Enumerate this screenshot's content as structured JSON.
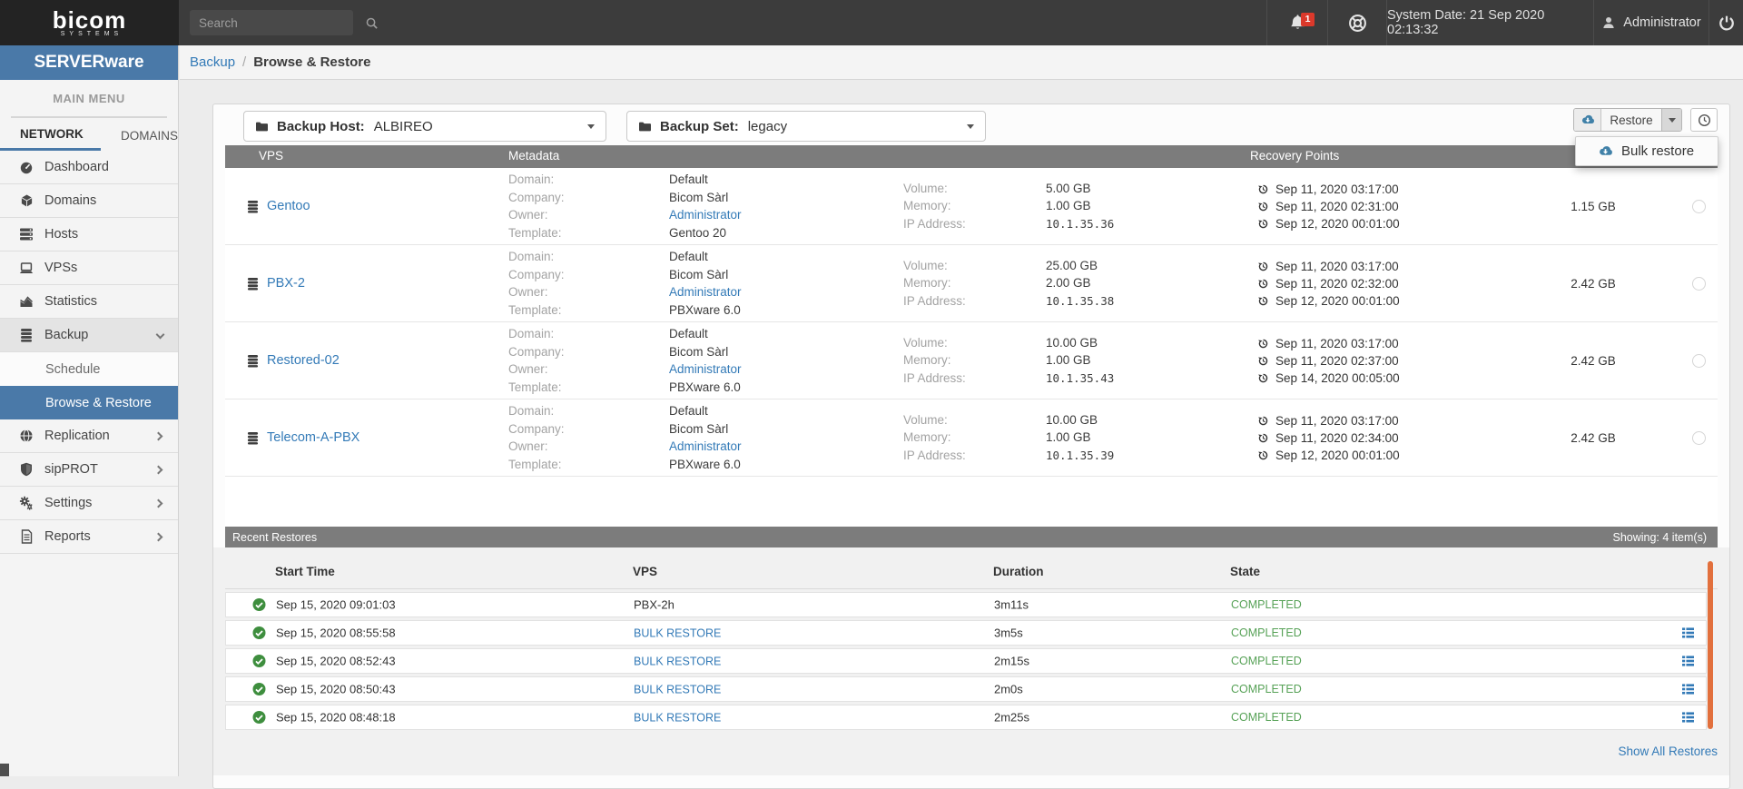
{
  "colors": {
    "accent_blue": "#4a79a8",
    "link_blue": "#337ab7",
    "success_green": "#57a257",
    "header_gray": "#7c7c7c",
    "scrollbar_orange": "#e2703d",
    "badge_red": "#db392b"
  },
  "topbar": {
    "logo_title": "bicom",
    "logo_subtitle": "SYSTEMS",
    "search_placeholder": "Search",
    "notification_count": "1",
    "system_date": "System Date: 21 Sep 2020 02:13:32",
    "user": "Administrator"
  },
  "sidebar": {
    "brand": "SERVERware",
    "section_label": "MAIN MENU",
    "tabs": {
      "network": "NETWORK",
      "domains": "DOMAINS"
    },
    "items": [
      {
        "label": "Dashboard"
      },
      {
        "label": "Domains"
      },
      {
        "label": "Hosts"
      },
      {
        "label": "VPSs"
      },
      {
        "label": "Statistics"
      },
      {
        "label": "Backup"
      },
      {
        "label": "Schedule"
      },
      {
        "label": "Browse & Restore"
      },
      {
        "label": "Replication"
      },
      {
        "label": "sipPROT"
      },
      {
        "label": "Settings"
      },
      {
        "label": "Reports"
      }
    ]
  },
  "breadcrumb": {
    "parent": "Backup",
    "separator": "/",
    "current": "Browse & Restore"
  },
  "toolbar": {
    "backup_host_label": "Backup Host:",
    "backup_host_value": "ALBIREO",
    "backup_set_label": "Backup Set:",
    "backup_set_value": "legacy",
    "restore_label": "Restore",
    "bulk_restore_label": "Bulk restore"
  },
  "vps_table": {
    "headers": {
      "vps": "VPS",
      "metadata": "Metadata",
      "recovery": "Recovery Points"
    },
    "meta_labels": {
      "domain": "Domain:",
      "company": "Company:",
      "owner": "Owner:",
      "template": "Template:",
      "volume": "Volume:",
      "memory": "Memory:",
      "ip": "IP Address:"
    },
    "rows": [
      {
        "name": "Gentoo",
        "domain": "Default",
        "company": "Bicom Sàrl",
        "owner": "Administrator",
        "template": "Gentoo 20",
        "volume": "5.00 GB",
        "memory": "1.00 GB",
        "ip": "10.1.35.36",
        "points": [
          "Sep 11, 2020 03:17:00",
          "Sep 11, 2020 02:31:00",
          "Sep 12, 2020 00:01:00"
        ],
        "size": "1.15 GB"
      },
      {
        "name": "PBX-2",
        "domain": "Default",
        "company": "Bicom Sàrl",
        "owner": "Administrator",
        "template": "PBXware 6.0",
        "volume": "25.00 GB",
        "memory": "2.00 GB",
        "ip": "10.1.35.38",
        "points": [
          "Sep 11, 2020 03:17:00",
          "Sep 11, 2020 02:32:00",
          "Sep 12, 2020 00:01:00"
        ],
        "size": "2.42 GB"
      },
      {
        "name": "Restored-02",
        "domain": "Default",
        "company": "Bicom Sàrl",
        "owner": "Administrator",
        "template": "PBXware 6.0",
        "volume": "10.00 GB",
        "memory": "1.00 GB",
        "ip": "10.1.35.43",
        "points": [
          "Sep 11, 2020 03:17:00",
          "Sep 11, 2020 02:37:00",
          "Sep 14, 2020 00:05:00"
        ],
        "size": "2.42 GB"
      },
      {
        "name": "Telecom-A-PBX",
        "domain": "Default",
        "company": "Bicom Sàrl",
        "owner": "Administrator",
        "template": "PBXware 6.0",
        "volume": "10.00 GB",
        "memory": "1.00 GB",
        "ip": "10.1.35.39",
        "points": [
          "Sep 11, 2020 03:17:00",
          "Sep 11, 2020 02:34:00",
          "Sep 12, 2020 00:01:00"
        ],
        "size": "2.42 GB"
      }
    ]
  },
  "recent": {
    "title": "Recent Restores",
    "showing": "Showing: 4 item(s)",
    "headers": {
      "start_time": "Start Time",
      "vps": "VPS",
      "duration": "Duration",
      "state": "State"
    },
    "rows": [
      {
        "time": "Sep 15, 2020 09:01:03",
        "vps": "PBX-2h",
        "vps_link": false,
        "vps_plain": true,
        "duration": "3m11s",
        "state": "COMPLETED",
        "details": false
      },
      {
        "time": "Sep 15, 2020 08:55:58",
        "vps": "BULK RESTORE",
        "vps_link": true,
        "vps_plain": false,
        "duration": "3m5s",
        "state": "COMPLETED",
        "details": true
      },
      {
        "time": "Sep 15, 2020 08:52:43",
        "vps": "BULK RESTORE",
        "vps_link": true,
        "vps_plain": false,
        "duration": "2m15s",
        "state": "COMPLETED",
        "details": true
      },
      {
        "time": "Sep 15, 2020 08:50:43",
        "vps": "BULK RESTORE",
        "vps_link": true,
        "vps_plain": false,
        "duration": "2m0s",
        "state": "COMPLETED",
        "details": true
      },
      {
        "time": "Sep 15, 2020 08:48:18",
        "vps": "BULK RESTORE",
        "vps_link": true,
        "vps_plain": false,
        "duration": "2m25s",
        "state": "COMPLETED",
        "details": true
      }
    ],
    "show_all": "Show All Restores"
  }
}
